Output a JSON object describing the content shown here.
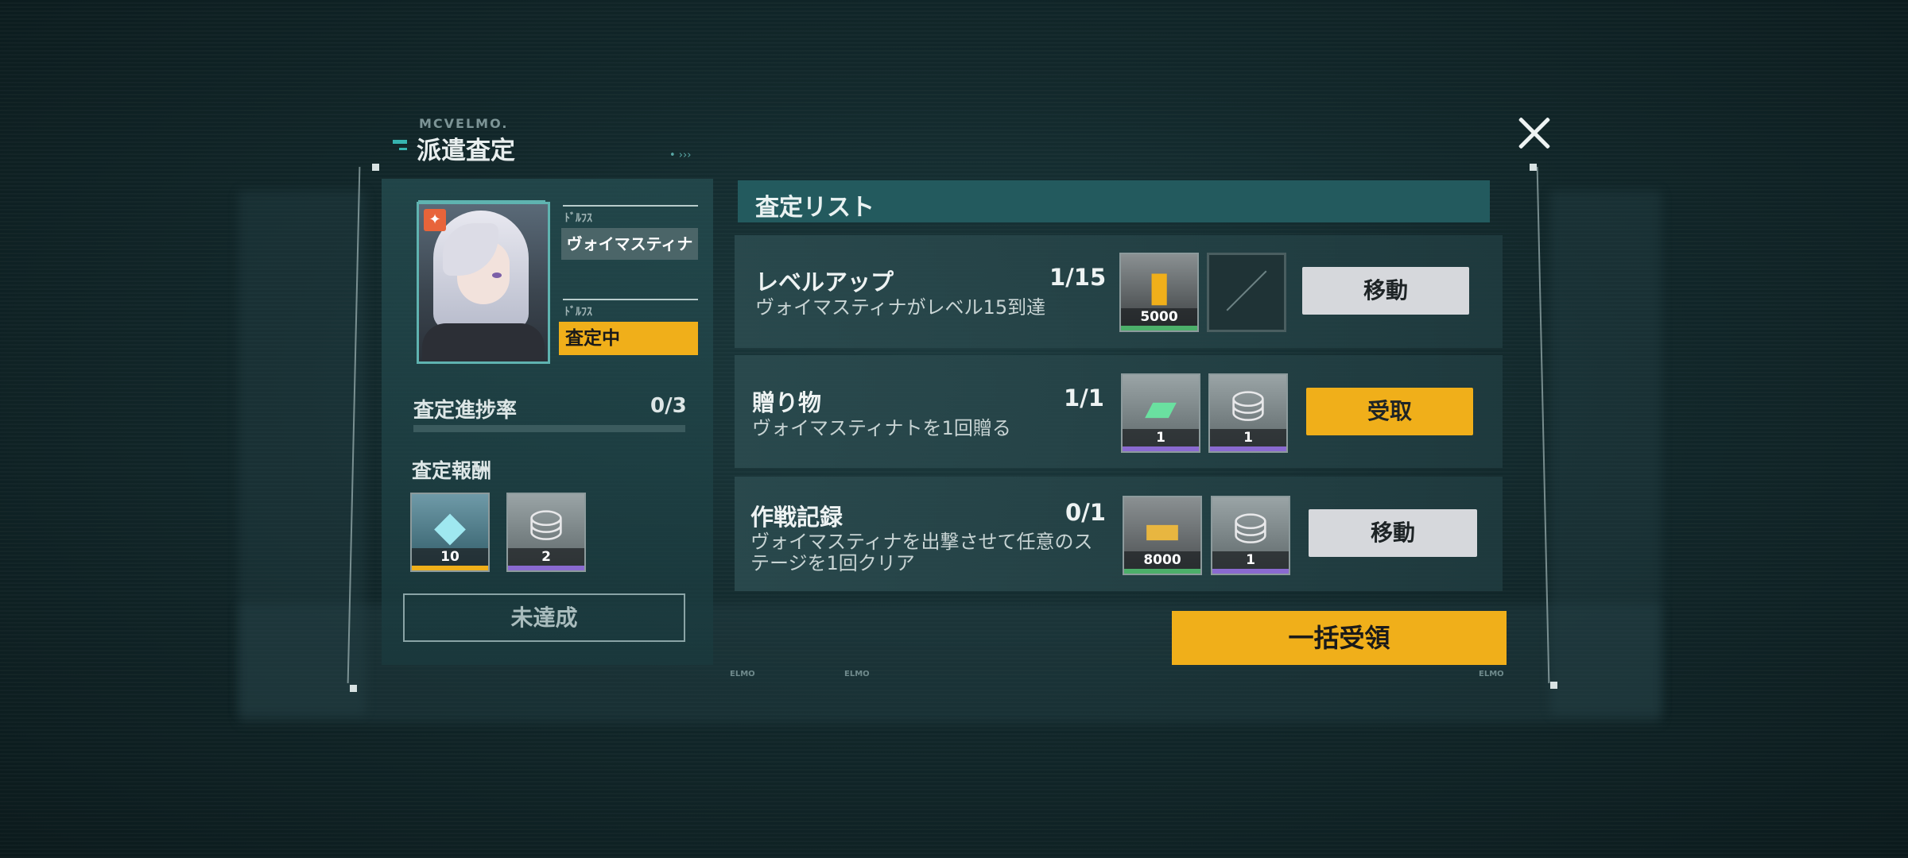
{
  "dialog": {
    "brand": "MCVELMO.",
    "title": "派遣査定",
    "close_icon": "close-icon"
  },
  "character": {
    "name_label": "ﾄﾞﾙﾌｽ",
    "name": "ヴォイマスティナ",
    "status_label": "ﾄﾞﾙﾌｽ",
    "status": "査定中",
    "status_color": "#f0af1a"
  },
  "progress": {
    "label": "査定進捗率",
    "count": "0/3",
    "fraction": 0.0
  },
  "rewards": {
    "label": "査定報酬",
    "items": [
      {
        "icon": "crystal-icon",
        "count": "10",
        "rarity_color": "#f0af1a"
      },
      {
        "icon": "battery-pack-icon",
        "count": "2",
        "rarity_color": "#8a6ad0"
      }
    ],
    "button": "未達成"
  },
  "list": {
    "title": "査定リスト",
    "rows": [
      {
        "title": "レベルアップ",
        "progress": "1/15",
        "desc": "ヴォイマスティナがレベル15到達",
        "rewards": [
          {
            "icon": "supply-case-icon",
            "count": "5000",
            "rarity_color": "#4caf6a"
          }
        ],
        "button": "移動",
        "button_type": "gray"
      },
      {
        "title": "贈り物",
        "progress": "1/1",
        "desc": "ヴォイマスティナトを1回贈る",
        "rewards": [
          {
            "icon": "data-chip-icon",
            "count": "1",
            "rarity_color": "#8a6ad0"
          },
          {
            "icon": "battery-pack-icon",
            "count": "1",
            "rarity_color": "#8a6ad0"
          }
        ],
        "button": "受取",
        "button_type": "yellow"
      },
      {
        "title": "作戦記録",
        "progress": "0/1",
        "desc_line1": "ヴォイマスティナを出撃させて任意のス",
        "desc_line2": "テージを1回クリア",
        "rewards": [
          {
            "icon": "gold-bar-icon",
            "count": "8000",
            "rarity_color": "#4caf6a"
          },
          {
            "icon": "battery-pack-icon",
            "count": "1",
            "rarity_color": "#8a6ad0"
          }
        ],
        "button": "移動",
        "button_type": "gray"
      }
    ],
    "bulk_button": "一括受領"
  },
  "footer": {
    "tag1": "ELMO",
    "tag2": "ELMO",
    "tag3": "ELMO"
  }
}
